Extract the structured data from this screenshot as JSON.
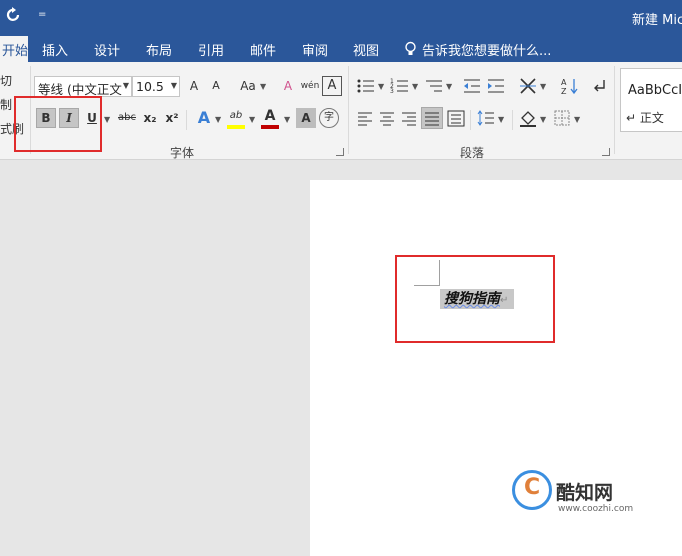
{
  "window": {
    "title": "新建 Mic",
    "qat_more": "="
  },
  "tabs": [
    "开始",
    "插入",
    "设计",
    "布局",
    "引用",
    "邮件",
    "审阅",
    "视图"
  ],
  "tell_me": "告诉我您想要做什么...",
  "clipboard": {
    "cut": "切",
    "copy": "制",
    "painter": "式刷"
  },
  "font": {
    "name": "等线 (中文正文",
    "size": "10.5",
    "grow": "A",
    "shrink": "A",
    "case": "Aa",
    "clear": "A",
    "phonetic": "wén",
    "border_char": "A",
    "bold": "B",
    "italic": "I",
    "underline": "U",
    "strike": "abc",
    "subscript": "x₂",
    "superscript": "x²",
    "text_effect": "A",
    "highlight": "ab",
    "font_color": "A",
    "shading": "A",
    "enclose": "字",
    "group_label": "字体"
  },
  "paragraph": {
    "group_label": "段落"
  },
  "styles": {
    "preview": "AaBbCcI",
    "normal": "↵ 正文"
  },
  "document": {
    "selected_text": "搜狗指南",
    "para_mark": "↵"
  },
  "watermark": {
    "logo_letter": "C",
    "name": "酷知网",
    "url": "www.coozhi.com"
  },
  "colors": {
    "brand": "#2b579a",
    "annotation": "#e02b2b",
    "font_color_bar": "#c00000",
    "highlight_bar": "#ffff00"
  }
}
